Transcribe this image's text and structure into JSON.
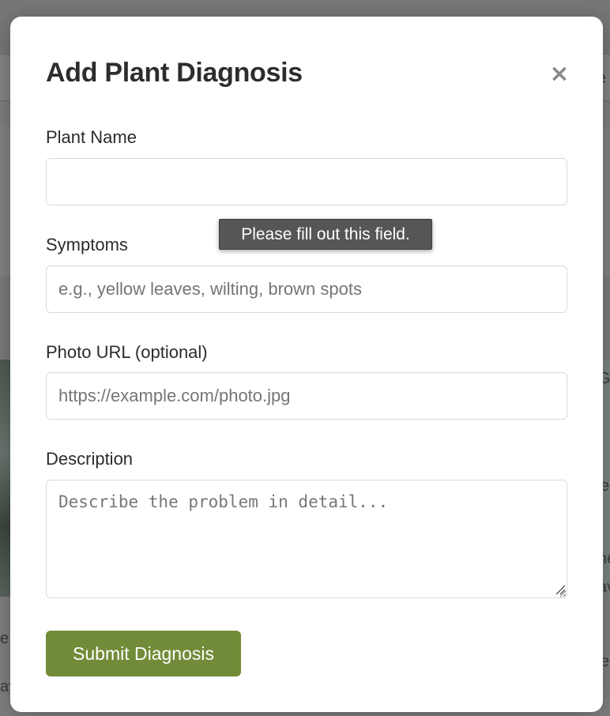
{
  "modal": {
    "title": "Add Plant Diagnosis",
    "close_glyph": "×"
  },
  "form": {
    "plant_name": {
      "label": "Plant Name",
      "value": "",
      "placeholder": ""
    },
    "symptoms": {
      "label": "Symptoms",
      "value": "",
      "placeholder": "e.g., yellow leaves, wilting, brown spots"
    },
    "photo_url": {
      "label": "Photo URL (optional)",
      "value": "",
      "placeholder": "https://example.com/photo.jpg"
    },
    "description": {
      "label": "Description",
      "value": "",
      "placeholder": "Describe the problem in detail..."
    },
    "submit_label": "Submit Diagnosis"
  },
  "validation_tooltip": "Please fill out this field.",
  "background": {
    "fragments": [
      "e",
      "e",
      "Ge",
      "e",
      "he",
      "av",
      "e",
      "ay",
      "e"
    ]
  },
  "colors": {
    "accent": "#728b38",
    "overlay": "#7b7b7b",
    "tooltip_bg": "#565656"
  },
  "icons": {
    "close": "close-icon",
    "resize": "resize-handle-icon"
  }
}
